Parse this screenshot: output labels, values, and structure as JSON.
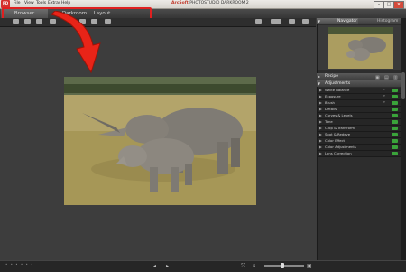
{
  "app": {
    "icon_text": "PD",
    "title_brand": "ArcSoft",
    "title_product": "PHOTOSTUDIO DARKROOM 2"
  },
  "menu": [
    "File",
    "View",
    "Tools",
    "Extras",
    "Help"
  ],
  "window_controls": {
    "minimize": "–",
    "maximize": "□",
    "close": "✕"
  },
  "tabs": [
    {
      "label": "Browser",
      "active": true
    },
    {
      "label": "Darkroom",
      "active": false
    },
    {
      "label": "Layout",
      "active": false
    }
  ],
  "panel": {
    "nav_tabs": [
      "Navigator",
      "Histogram"
    ],
    "recipe_label": "Recipe",
    "adjustments_label": "Adjustments",
    "adjustments": [
      "White Balance",
      "Exposure",
      "Brush",
      "Details",
      "Curves & Levels",
      "Tone",
      "Crop & Transform",
      "Spot & Redeye",
      "Color Effect",
      "Color Adjustments",
      "Lens Correction"
    ]
  },
  "bottom": {
    "dots": "• • • • • •",
    "zoom_icon_minus": "▫",
    "zoom_icon_plus": "▣"
  },
  "colors": {
    "highlight": "#e02020",
    "toggle_on": "#3aa33a",
    "app_icon": "#d4312d"
  }
}
